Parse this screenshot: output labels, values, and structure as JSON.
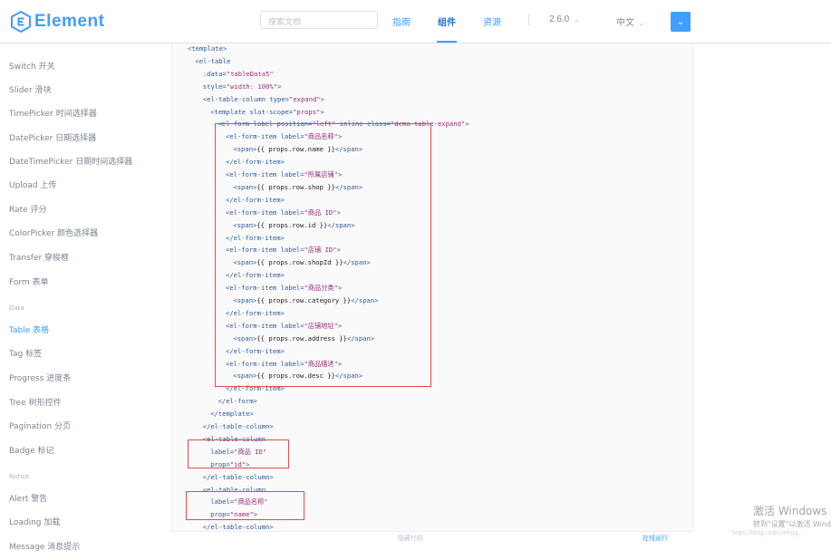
{
  "header": {
    "logo_text": "Element",
    "search_placeholder": "搜索文档",
    "nav": [
      "指南",
      "组件",
      "资源"
    ],
    "active_nav": "组件",
    "version": "2.6.0",
    "language": "中文",
    "theme_icon": "chevron-down-icon",
    "accent_color": "#409eff"
  },
  "sidebar": {
    "items_top": [
      "Switch 开关",
      "Slider 滑块",
      "TimePicker 时间选择器",
      "DatePicker 日期选择器",
      "DateTimePicker 日期时间选择器",
      "Upload 上传",
      "Rate 评分",
      "ColorPicker 颜色选择器",
      "Transfer 穿梭框",
      "Form 表单"
    ],
    "group_data": "Data",
    "items_data": [
      "Table 表格",
      "Tag 标签",
      "Progress 进度条",
      "Tree 树形控件",
      "Pagination 分页",
      "Badge 标记"
    ],
    "active_item": "Table 表格",
    "group_notice": "Notice",
    "items_notice": [
      "Alert 警告",
      "Loading 加载",
      "Message 消息提示"
    ]
  },
  "code": {
    "lines": [
      "<template>",
      "  <el-table",
      "    :data=\"tableData5\"",
      "    style=\"width: 100%\">",
      "    <el-table-column type=\"expand\">",
      "      <template slot-scope=\"props\">",
      "        <el-form label-position=\"left\" inline class=\"demo-table-expand\">",
      "          <el-form-item label=\"商品名称\">",
      "            <span>{{ props.row.name }}</span>",
      "          </el-form-item>",
      "          <el-form-item label=\"所属店铺\">",
      "            <span>{{ props.row.shop }}</span>",
      "          </el-form-item>",
      "          <el-form-item label=\"商品 ID\">",
      "            <span>{{ props.row.id }}</span>",
      "          </el-form-item>",
      "          <el-form-item label=\"店铺 ID\">",
      "            <span>{{ props.row.shopId }}</span>",
      "          </el-form-item>",
      "          <el-form-item label=\"商品分类\">",
      "            <span>{{ props.row.category }}</span>",
      "          </el-form-item>",
      "          <el-form-item label=\"店铺地址\">",
      "            <span>{{ props.row.address }}</span>",
      "          </el-form-item>",
      "          <el-form-item label=\"商品描述\">",
      "            <span>{{ props.row.desc }}</span>",
      "          </el-form-item>",
      "        </el-form>",
      "      </template>",
      "    </el-table-column>",
      "    <el-table-column",
      "      label=\"商品 ID\"",
      "      prop=\"id\">",
      "    </el-table-column>",
      "    <el-table-column",
      "      label=\"商品名称\"",
      "      prop=\"name\">",
      "    </el-table-column>"
    ],
    "footer_hide": "隐藏代码",
    "footer_online": "在线运行"
  },
  "watermark": {
    "line1": "激活 Windows",
    "line2": "转到\"设置\"以激活 Windows。",
    "line3": "https://blog.csdn.net/qq_"
  }
}
